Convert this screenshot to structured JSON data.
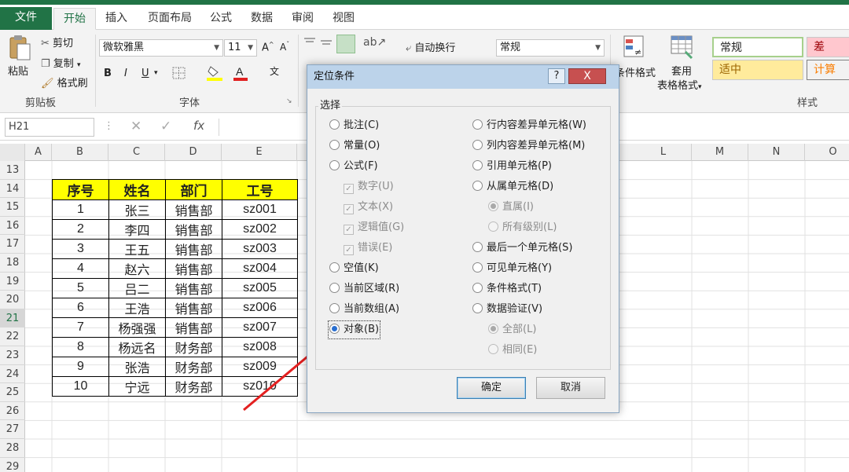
{
  "ribbon_tabs": [
    "文件",
    "开始",
    "插入",
    "页面布局",
    "公式",
    "数据",
    "审阅",
    "视图"
  ],
  "clipboard": {
    "paste": "粘贴",
    "cut": "剪切",
    "copy": "复制",
    "format_painter": "格式刷",
    "group_label": "剪贴板"
  },
  "font": {
    "name": "微软雅黑",
    "size": "11",
    "bold": "B",
    "italic": "I",
    "underline": "U",
    "group_label": "字体"
  },
  "alignment": {
    "wrap_text": "自动换行"
  },
  "number": {
    "format": "常规"
  },
  "styles": {
    "conditional_format": "条件格式",
    "table_format_1": "套用",
    "table_format_2": "表格格式",
    "normal": "常规",
    "bad": "差",
    "neutral": "适中",
    "calculation": "计算",
    "group_label": "样式"
  },
  "formula_bar": {
    "name_box": "H21",
    "fx": "fx"
  },
  "columns": [
    "A",
    "B",
    "C",
    "D",
    "E",
    "L",
    "M",
    "N",
    "O"
  ],
  "rows": [
    "13",
    "14",
    "15",
    "16",
    "17",
    "18",
    "19",
    "20",
    "21",
    "22",
    "23",
    "24",
    "25",
    "26",
    "27",
    "28",
    "29"
  ],
  "table": {
    "headers": [
      "序号",
      "姓名",
      "部门",
      "工号"
    ],
    "rows": [
      [
        "1",
        "张三",
        "销售部",
        "sz001"
      ],
      [
        "2",
        "李四",
        "销售部",
        "sz002"
      ],
      [
        "3",
        "王五",
        "销售部",
        "sz003"
      ],
      [
        "4",
        "赵六",
        "销售部",
        "sz004"
      ],
      [
        "5",
        "吕二",
        "销售部",
        "sz005"
      ],
      [
        "6",
        "王浩",
        "销售部",
        "sz006"
      ],
      [
        "7",
        "杨强强",
        "销售部",
        "sz007"
      ],
      [
        "8",
        "杨远名",
        "财务部",
        "sz008"
      ],
      [
        "9",
        "张浩",
        "财务部",
        "sz009"
      ],
      [
        "10",
        "宁远",
        "财务部",
        "sz010"
      ]
    ]
  },
  "dialog": {
    "title": "定位条件",
    "help": "?",
    "close": "X",
    "group_label": "选择",
    "left_options": [
      {
        "label": "批注(C)",
        "type": "radio",
        "checked": false,
        "disabled": false
      },
      {
        "label": "常量(O)",
        "type": "radio",
        "checked": false,
        "disabled": false
      },
      {
        "label": "公式(F)",
        "type": "radio",
        "checked": false,
        "disabled": false
      },
      {
        "label": "数字(U)",
        "type": "check",
        "checked": true,
        "disabled": true
      },
      {
        "label": "文本(X)",
        "type": "check",
        "checked": true,
        "disabled": true
      },
      {
        "label": "逻辑值(G)",
        "type": "check",
        "checked": true,
        "disabled": true
      },
      {
        "label": "错误(E)",
        "type": "check",
        "checked": true,
        "disabled": true
      },
      {
        "label": "空值(K)",
        "type": "radio",
        "checked": false,
        "disabled": false
      },
      {
        "label": "当前区域(R)",
        "type": "radio",
        "checked": false,
        "disabled": false
      },
      {
        "label": "当前数组(A)",
        "type": "radio",
        "checked": false,
        "disabled": false
      },
      {
        "label": "对象(B)",
        "type": "radio",
        "checked": true,
        "disabled": false
      }
    ],
    "right_options": [
      {
        "label": "行内容差异单元格(W)",
        "type": "radio",
        "checked": false,
        "disabled": false
      },
      {
        "label": "列内容差异单元格(M)",
        "type": "radio",
        "checked": false,
        "disabled": false
      },
      {
        "label": "引用单元格(P)",
        "type": "radio",
        "checked": false,
        "disabled": false
      },
      {
        "label": "从属单元格(D)",
        "type": "radio",
        "checked": false,
        "disabled": false
      },
      {
        "label": "直属(I)",
        "type": "radio",
        "checked": true,
        "disabled": true
      },
      {
        "label": "所有级别(L)",
        "type": "radio",
        "checked": false,
        "disabled": true
      },
      {
        "label": "最后一个单元格(S)",
        "type": "radio",
        "checked": false,
        "disabled": false
      },
      {
        "label": "可见单元格(Y)",
        "type": "radio",
        "checked": false,
        "disabled": false
      },
      {
        "label": "条件格式(T)",
        "type": "radio",
        "checked": false,
        "disabled": false
      },
      {
        "label": "数据验证(V)",
        "type": "radio",
        "checked": false,
        "disabled": false
      },
      {
        "label": "全部(L)",
        "type": "radio",
        "checked": true,
        "disabled": true
      },
      {
        "label": "相同(E)",
        "type": "radio",
        "checked": false,
        "disabled": true
      }
    ],
    "ok": "确定",
    "cancel": "取消"
  },
  "colors": {
    "excel_green": "#217346",
    "header_yellow": "#ffff00",
    "arrow_red": "#e32020",
    "dialog_title": "#bcd3ea"
  }
}
